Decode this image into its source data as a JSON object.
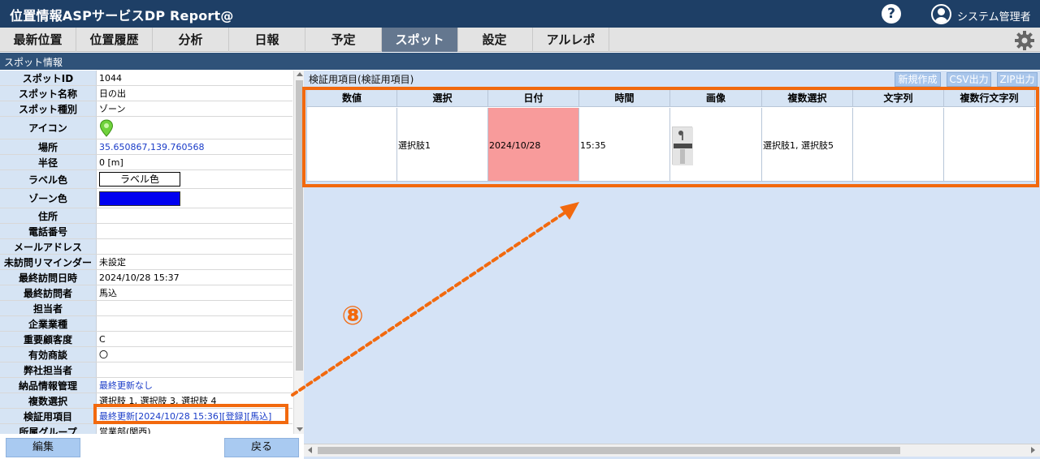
{
  "header": {
    "app_title": "位置情報ASPサービスDP Report@",
    "help_label": "?",
    "user_name": "システム管理者"
  },
  "tabs": [
    "最新位置",
    "位置履歴",
    "分析",
    "日報",
    "予定",
    "スポット",
    "設定",
    "アルレポ"
  ],
  "active_tab": "スポット",
  "section_title": "スポット情報",
  "spot_info": [
    {
      "label": "スポットID",
      "value": "1044"
    },
    {
      "label": "スポット名称",
      "value": "日の出"
    },
    {
      "label": "スポット種別",
      "value": "ゾーン"
    },
    {
      "label": "アイコン",
      "value": ""
    },
    {
      "label": "場所",
      "value": "35.650867,139.760568"
    },
    {
      "label": "半径",
      "value": "0 [m]"
    },
    {
      "label": "ラベル色",
      "value": "ラベル色"
    },
    {
      "label": "ゾーン色",
      "value": ""
    },
    {
      "label": "住所",
      "value": ""
    },
    {
      "label": "電話番号",
      "value": ""
    },
    {
      "label": "メールアドレス",
      "value": ""
    },
    {
      "label": "未訪問リマインダー",
      "value": "未設定"
    },
    {
      "label": "最終訪問日時",
      "value": "2024/10/28 15:37"
    },
    {
      "label": "最終訪問者",
      "value": "馬込"
    },
    {
      "label": "担当者",
      "value": ""
    },
    {
      "label": "企業業種",
      "value": ""
    },
    {
      "label": "重要顧客度",
      "value": "C"
    },
    {
      "label": "有効商談",
      "value": "〇"
    },
    {
      "label": "弊社担当者",
      "value": ""
    },
    {
      "label": "納品情報管理",
      "value": "最終更新なし"
    },
    {
      "label": "複数選択",
      "value": "選択肢 1, 選択肢 3, 選択肢 4"
    },
    {
      "label": "検証用項目",
      "value": "最終更新[2024/10/28 15:36][登録][馬込]"
    },
    {
      "label": "所属グループ",
      "value": "営業部(関西)"
    }
  ],
  "colors": {
    "header_bg": "#1e3f66",
    "tab_active_bg": "#64778f",
    "label_cell_bg": "#d6e4f4",
    "zone_color": "#0000f0",
    "date_cell_bg": "#f89b9b",
    "annotation": "#f2690e",
    "link": "#1a3cc8",
    "icon_pin": "#6fd23c"
  },
  "buttons": {
    "edit": "編集",
    "back": "戻る"
  },
  "right_panel": {
    "title": "検証用項目(検証用項目)",
    "actions": [
      "新規作成",
      "CSV出力",
      "ZIP出力"
    ],
    "columns": [
      "数値",
      "選択",
      "日付",
      "時間",
      "画像",
      "複数選択",
      "文字列",
      "複数行文字列"
    ],
    "row": [
      "",
      "選択肢1",
      "2024/10/28",
      "15:35",
      "",
      "選択肢1, 選択肢5",
      "",
      ""
    ]
  },
  "annotation": {
    "number": "⑧"
  },
  "icons": {
    "help": "help-icon",
    "user": "user-icon",
    "settings": "gear-icon",
    "spot": "map-pin-icon"
  }
}
